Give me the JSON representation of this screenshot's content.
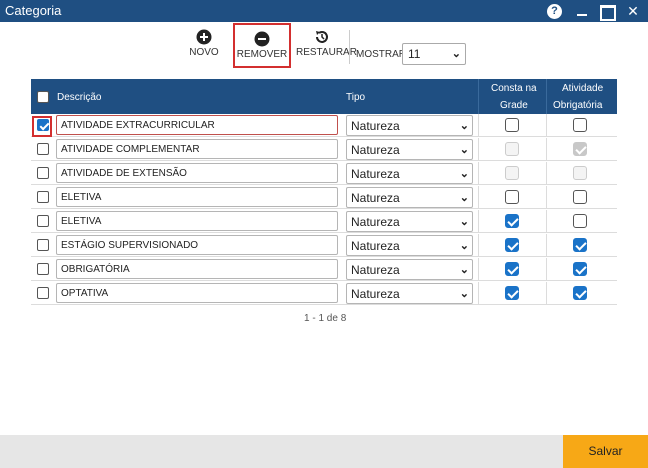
{
  "window": {
    "title": "Categoria",
    "help_label": "?",
    "close_label": "✕"
  },
  "toolbar": {
    "novo_label": "NOVO",
    "remover_label": "REMOVER",
    "restaurar_label": "RESTAURAR",
    "mostrar_label": "MOSTRAR:",
    "mostrar_value": "11"
  },
  "grid": {
    "headers": {
      "descricao": "Descrição",
      "tipo": "Tipo",
      "consta_line1": "Consta na",
      "consta_line2": "Grade",
      "atividade_line1": "Atividade",
      "atividade_line2": "Obrigatória"
    },
    "rows": [
      {
        "selected": true,
        "descricao": "ATIVIDADE EXTRACURRICULAR",
        "tipo": "Natureza",
        "consta": false,
        "consta_disabled": false,
        "obrigatoria": false,
        "obrigatoria_disabled": false
      },
      {
        "selected": false,
        "descricao": "ATIVIDADE COMPLEMENTAR",
        "tipo": "Natureza",
        "consta": false,
        "consta_disabled": true,
        "obrigatoria": true,
        "obrigatoria_disabled": true
      },
      {
        "selected": false,
        "descricao": "ATIVIDADE DE EXTENSÃO",
        "tipo": "Natureza",
        "consta": false,
        "consta_disabled": true,
        "obrigatoria": false,
        "obrigatoria_disabled": true
      },
      {
        "selected": false,
        "descricao": "ELETIVA",
        "tipo": "Natureza",
        "consta": false,
        "consta_disabled": false,
        "obrigatoria": false,
        "obrigatoria_disabled": false
      },
      {
        "selected": false,
        "descricao": "ELETIVA",
        "tipo": "Natureza",
        "consta": true,
        "consta_disabled": false,
        "obrigatoria": false,
        "obrigatoria_disabled": false
      },
      {
        "selected": false,
        "descricao": "ESTÁGIO SUPERVISIONADO",
        "tipo": "Natureza",
        "consta": true,
        "consta_disabled": false,
        "obrigatoria": true,
        "obrigatoria_disabled": false
      },
      {
        "selected": false,
        "descricao": "OBRIGATÓRIA",
        "tipo": "Natureza",
        "consta": true,
        "consta_disabled": false,
        "obrigatoria": true,
        "obrigatoria_disabled": false
      },
      {
        "selected": false,
        "descricao": "OPTATIVA",
        "tipo": "Natureza",
        "consta": true,
        "consta_disabled": false,
        "obrigatoria": true,
        "obrigatoria_disabled": false
      }
    ]
  },
  "pager": {
    "text": "1 - 1 de 8"
  },
  "footer": {
    "save_label": "Salvar"
  },
  "colors": {
    "header_bg": "#1f4f82",
    "accent_checkbox": "#1a73c8",
    "highlight_red": "#d32f2f",
    "save_button": "#f7a816"
  }
}
